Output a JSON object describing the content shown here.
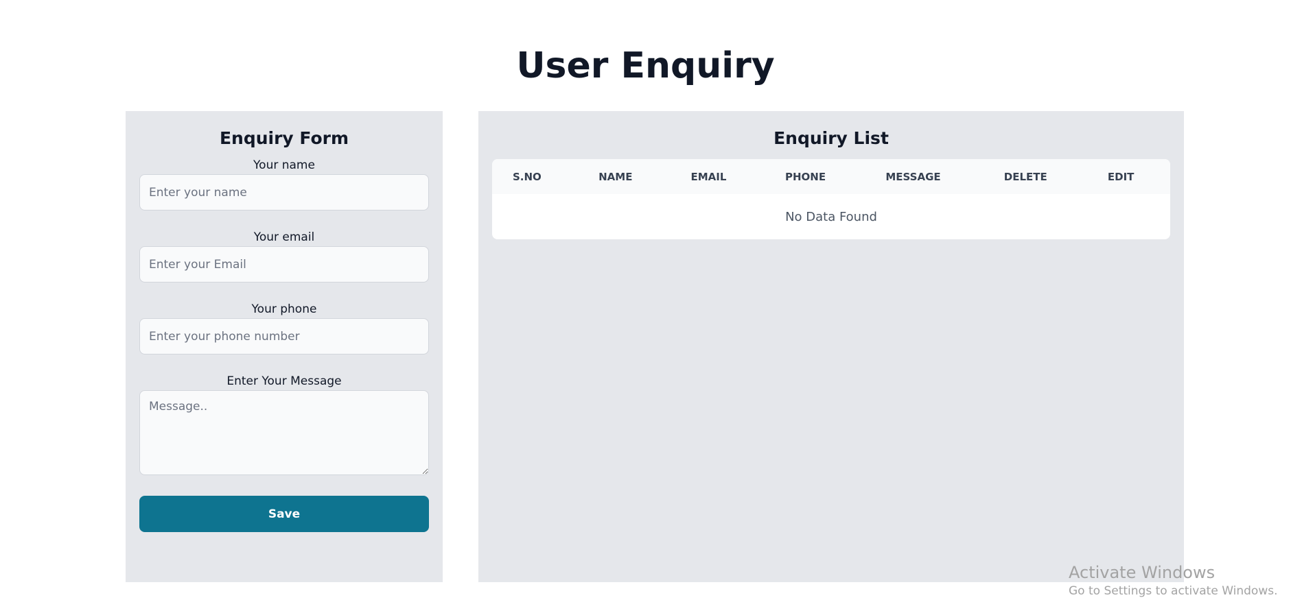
{
  "page": {
    "title": "User Enquiry"
  },
  "form": {
    "heading": "Enquiry Form",
    "name": {
      "label": "Your name",
      "placeholder": "Enter your name"
    },
    "email": {
      "label": "Your email",
      "placeholder": "Enter your Email"
    },
    "phone": {
      "label": "Your phone",
      "placeholder": "Enter your phone number"
    },
    "message": {
      "label": "Enter Your Message",
      "placeholder": "Message.."
    },
    "save_label": "Save",
    "save_color": "#0e7490"
  },
  "list": {
    "heading": "Enquiry List",
    "columns": [
      "S.NO",
      "NAME",
      "EMAIL",
      "PHONE",
      "MESSAGE",
      "DELETE",
      "EDIT"
    ],
    "empty_text": "No Data Found"
  },
  "watermark": {
    "title": "Activate Windows",
    "subtitle": "Go to Settings to activate Windows."
  },
  "colors": {
    "panel_bg": "#e5e7eb",
    "accent": "#0e7490"
  }
}
